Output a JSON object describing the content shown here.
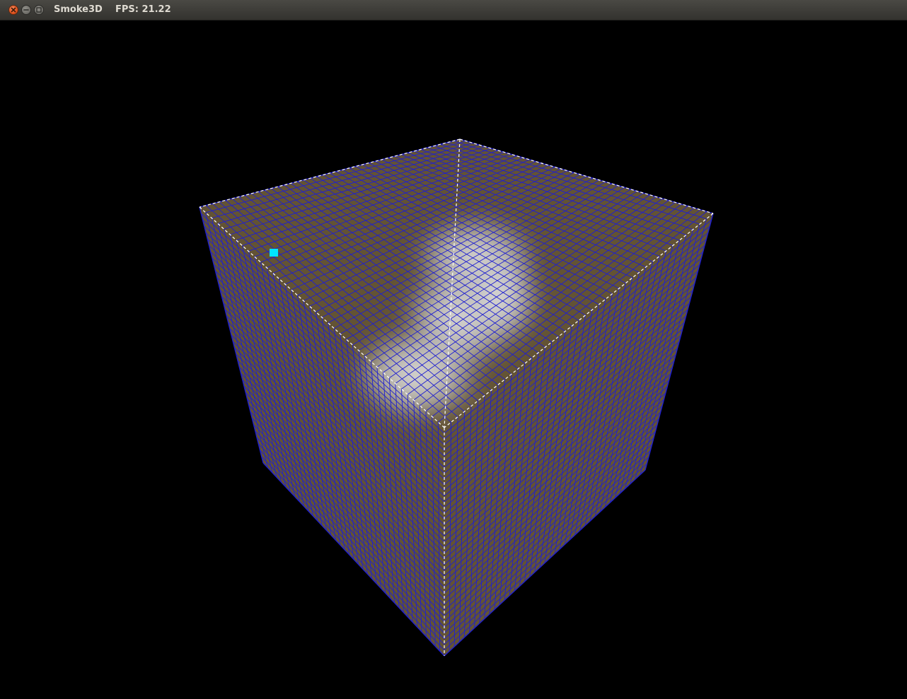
{
  "window": {
    "app_name": "Smoke3D",
    "fps_label": "FPS: 21.22",
    "buttons": {
      "close": "close-icon",
      "minimize": "minimize-icon",
      "maximize": "maximize-icon"
    }
  },
  "scene": {
    "background": "#000000",
    "face_color": "#6b5a38",
    "grid_color": "#1f1fd0",
    "edge_color": "#ffffff",
    "smoke_color": "#d8d8d8",
    "marker_color": "#00e5ff"
  }
}
